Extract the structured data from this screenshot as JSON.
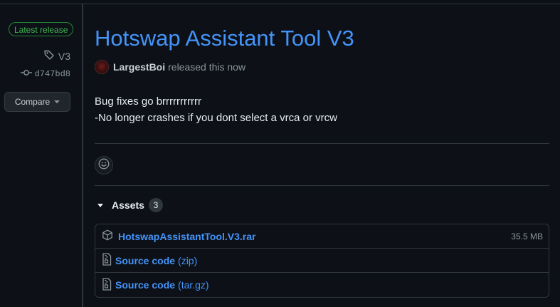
{
  "sidebar": {
    "badge": "Latest release",
    "tag": "V3",
    "commit": "d747bd8",
    "compare_label": "Compare"
  },
  "release": {
    "title": "Hotswap Assistant Tool V3",
    "author": "LargestBoi",
    "released_text": "released this now",
    "body_lines": [
      "Bug fixes go brrrrrrrrrrr",
      "-No longer crashes if you dont select a vrca or vrcw"
    ]
  },
  "assets": {
    "label": "Assets",
    "count": "3",
    "items": [
      {
        "name": "HotswapAssistantTool.V3.rar",
        "size": "35.5 MB",
        "icon": "package-icon"
      },
      {
        "name": "Source code",
        "suffix": "(zip)",
        "icon": "file-zip-icon"
      },
      {
        "name": "Source code",
        "suffix": "(tar.gz)",
        "icon": "file-zip-icon"
      }
    ]
  },
  "colors": {
    "background": "#0d1117",
    "link": "#4493f8",
    "success": "#3fb950",
    "border": "#30363d",
    "muted": "#8b949e"
  }
}
